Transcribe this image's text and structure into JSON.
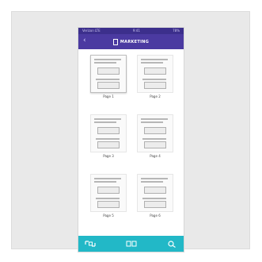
{
  "status_bar": {
    "left": "Verizon LTE",
    "center": "9:41",
    "right": "78%"
  },
  "header": {
    "title": "MARKETING"
  },
  "pages": [
    {
      "label": "Page 1",
      "selected": true
    },
    {
      "label": "Page 2",
      "selected": false
    },
    {
      "label": "Page 3",
      "selected": false
    },
    {
      "label": "Page 4",
      "selected": false
    },
    {
      "label": "Page 5",
      "selected": false
    },
    {
      "label": "Page 6",
      "selected": false
    }
  ],
  "bottom_bar": {
    "left_icon": "scan-icon",
    "center_icon": "pages-icon",
    "right_icon": "search-icon"
  },
  "colors": {
    "header": "#4b3aa1",
    "status": "#3c2f8c",
    "toolbar": "#22b8c7"
  }
}
